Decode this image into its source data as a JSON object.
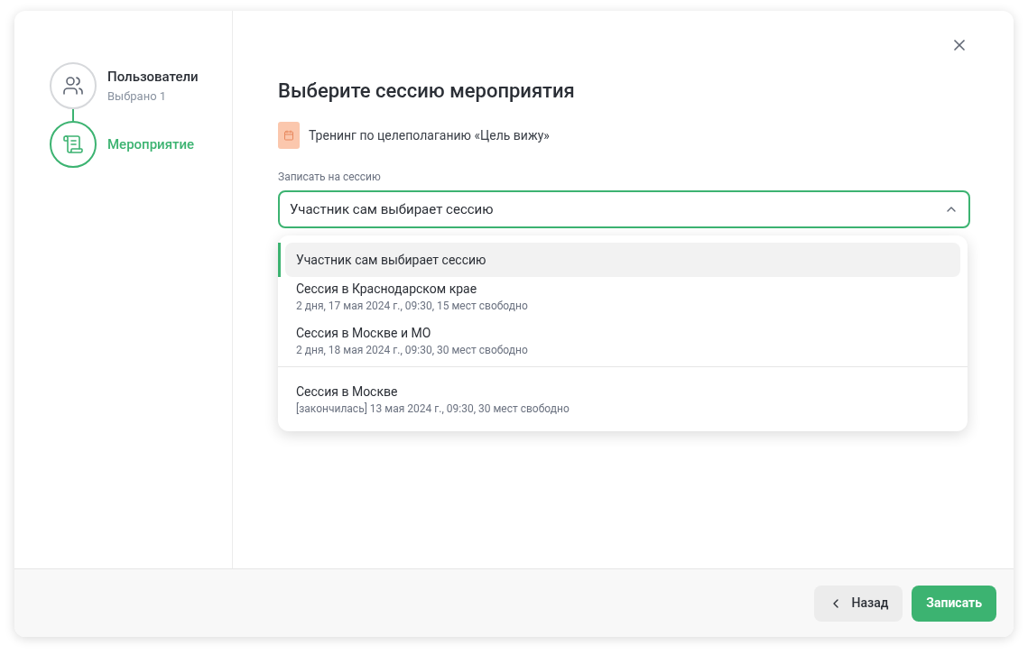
{
  "steps": [
    {
      "title": "Пользователи",
      "subtitle": "Выбрано 1",
      "active": false,
      "kind": "users"
    },
    {
      "title": "Мероприятие",
      "active": true,
      "kind": "event"
    }
  ],
  "title": "Выберите сессию мероприятия",
  "event": {
    "name": "Тренинг по целеполаганию «Цель вижу»"
  },
  "select": {
    "label": "Записать на сессию",
    "value": "Участник сам выбирает сессию",
    "expanded": true
  },
  "option_groups": [
    [
      {
        "title": "Участник сам выбирает сессию",
        "selected": true
      },
      {
        "title": "Сессия в Краснодарском крае",
        "details": "2 дня, 17 мая 2024 г., 09:30, 15 мест свободно",
        "selected": false
      },
      {
        "title": "Сессия в Москве и МО",
        "details": "2 дня, 18 мая 2024 г., 09:30, 30 мест свободно",
        "selected": false
      }
    ],
    [
      {
        "title": "Сессия в Москве",
        "details": "[закончилась] 13 мая 2024 г., 09:30, 30 мест свободно",
        "selected": false
      }
    ]
  ],
  "buttons": [
    {
      "label": "Назад",
      "kind": "back"
    },
    {
      "label": "Записать",
      "kind": "primary"
    }
  ]
}
